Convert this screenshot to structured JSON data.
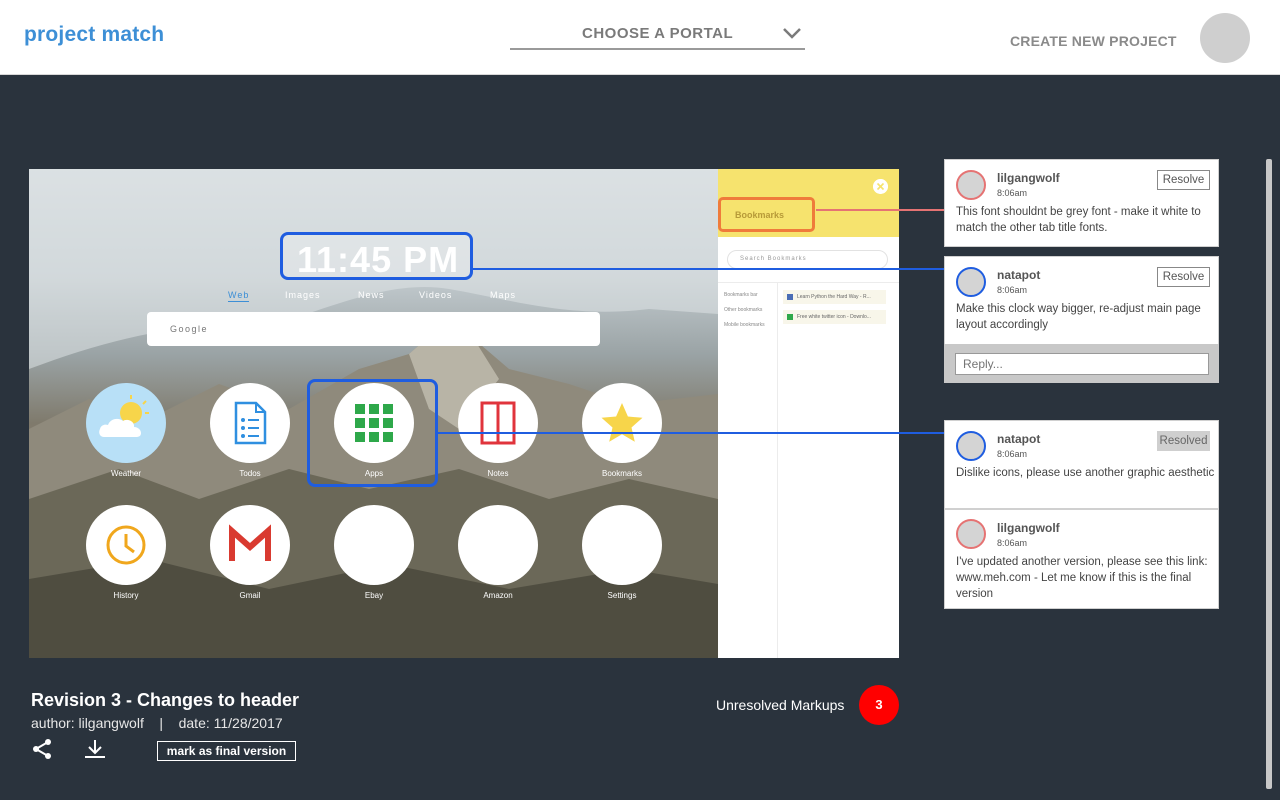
{
  "header": {
    "logo": "project match",
    "portal_select": "CHOOSE A PORTAL",
    "create_project": "CREATE NEW PROJECT",
    "avatar_icon": "user-avatar"
  },
  "preview": {
    "clock": "11:45 PM",
    "tabs": [
      "Web",
      "Images",
      "News",
      "Videos",
      "Maps"
    ],
    "search_placeholder": "Google",
    "tiles": [
      {
        "label": "Weather",
        "icon": "weather-icon"
      },
      {
        "label": "Todos",
        "icon": "todos-icon"
      },
      {
        "label": "Apps",
        "icon": "apps-grid-icon"
      },
      {
        "label": "Notes",
        "icon": "notes-icon"
      },
      {
        "label": "Bookmarks",
        "icon": "star-icon"
      },
      {
        "label": "History",
        "icon": "clock-icon"
      },
      {
        "label": "Gmail",
        "icon": "gmail-icon"
      },
      {
        "label": "Ebay",
        "icon": ""
      },
      {
        "label": "Amazon",
        "icon": ""
      },
      {
        "label": "Settings",
        "icon": ""
      }
    ],
    "bookmarks": {
      "title": "Bookmarks",
      "search_placeholder": "Search Bookmarks",
      "side_items": [
        "Bookmarks bar",
        "Other bookmarks",
        "Mobile bookmarks"
      ],
      "links": [
        "Learn Python the Hard Way - R...",
        "Free white twitter icon - Downlo..."
      ]
    }
  },
  "comments": [
    {
      "user": "lilgangwolf",
      "time": "8:06am",
      "text": "This font shouldnt be grey font - make it white to match the other tab title fonts.",
      "button": "Resolve",
      "color": "#e57373"
    },
    {
      "user": "natapot",
      "time": "8:06am",
      "text": "Make this clock way bigger, re-adjust main page layout accordingly",
      "button": "Resolve",
      "color": "#1f5de0"
    },
    {
      "user": "natapot",
      "time": "8:06am",
      "text": "Dislike icons, please use another graphic aesthetic",
      "button": "Resolved",
      "color": "#1f5de0"
    },
    {
      "user": "lilgangwolf",
      "time": "8:06am",
      "text": "I've updated another version, please see this link: www.meh.com - Let me know if this is the final version",
      "button": "",
      "color": "#e57373"
    }
  ],
  "reply_placeholder": "Reply...",
  "revision": {
    "title": "Revision 3 - Changes to header",
    "meta": "author: lilgangwolf    |    date: 11/28/2017",
    "final_button": "mark as final version"
  },
  "markups": {
    "label": "Unresolved Markups",
    "count": "3"
  },
  "colors": {
    "accent": "#3d8fd6",
    "markup_blue": "#1f5de0",
    "markup_orange": "#ef7b3b",
    "badge_red": "#ff0000",
    "background": "#2a333d"
  }
}
